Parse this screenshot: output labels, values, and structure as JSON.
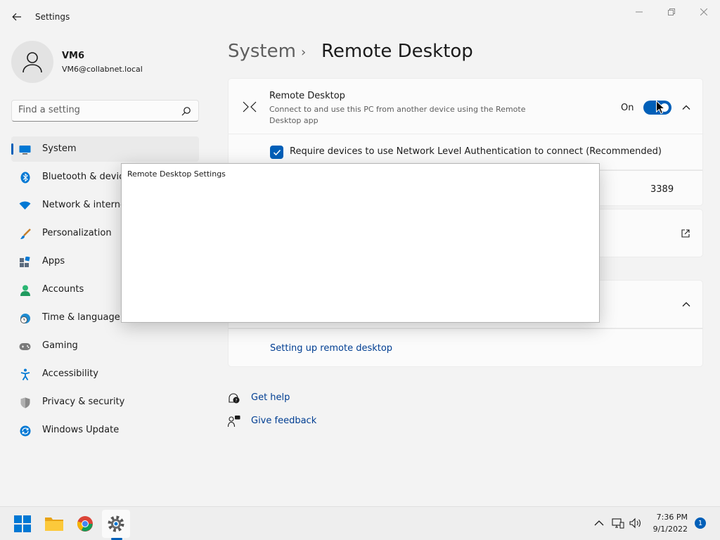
{
  "window": {
    "app_title": "Settings"
  },
  "profile": {
    "name": "VM6",
    "email": "VM6@collabnet.local"
  },
  "search": {
    "placeholder": "Find a setting"
  },
  "sidebar": {
    "items": [
      {
        "label": "System",
        "icon": "system-icon",
        "active": true
      },
      {
        "label": "Bluetooth & devices",
        "icon": "bluetooth-icon"
      },
      {
        "label": "Network & internet",
        "icon": "wifi-icon"
      },
      {
        "label": "Personalization",
        "icon": "brush-icon"
      },
      {
        "label": "Apps",
        "icon": "apps-icon"
      },
      {
        "label": "Accounts",
        "icon": "person-icon"
      },
      {
        "label": "Time & language",
        "icon": "clock-globe-icon"
      },
      {
        "label": "Gaming",
        "icon": "gamepad-icon"
      },
      {
        "label": "Accessibility",
        "icon": "accessibility-icon"
      },
      {
        "label": "Privacy & security",
        "icon": "shield-icon"
      },
      {
        "label": "Windows Update",
        "icon": "update-icon"
      }
    ]
  },
  "breadcrumb": {
    "parent": "System",
    "separator": "›",
    "current": "Remote Desktop"
  },
  "remote_desktop": {
    "title": "Remote Desktop",
    "description": "Connect to and use this PC from another device using the Remote Desktop app",
    "state_label": "On",
    "toggle_on": true,
    "nla_label": "Require devices to use Network Level Authentication to connect (Recommended)",
    "nla_checked": true,
    "port_value": "3389"
  },
  "related": {
    "setup_link": "Setting up remote desktop"
  },
  "help": {
    "get_help": "Get help",
    "give_feedback": "Give feedback"
  },
  "dialog": {
    "title": "Remote Desktop Settings"
  },
  "taskbar": {
    "apps": [
      "start-icon",
      "file-explorer-icon",
      "chrome-icon",
      "settings-icon"
    ],
    "time": "7:36 PM",
    "date": "9/1/2022",
    "notification_count": "1"
  },
  "colors": {
    "accent": "#005fb8",
    "link": "#003e92",
    "background": "#f3f3f3",
    "card": "#fbfbfb"
  }
}
